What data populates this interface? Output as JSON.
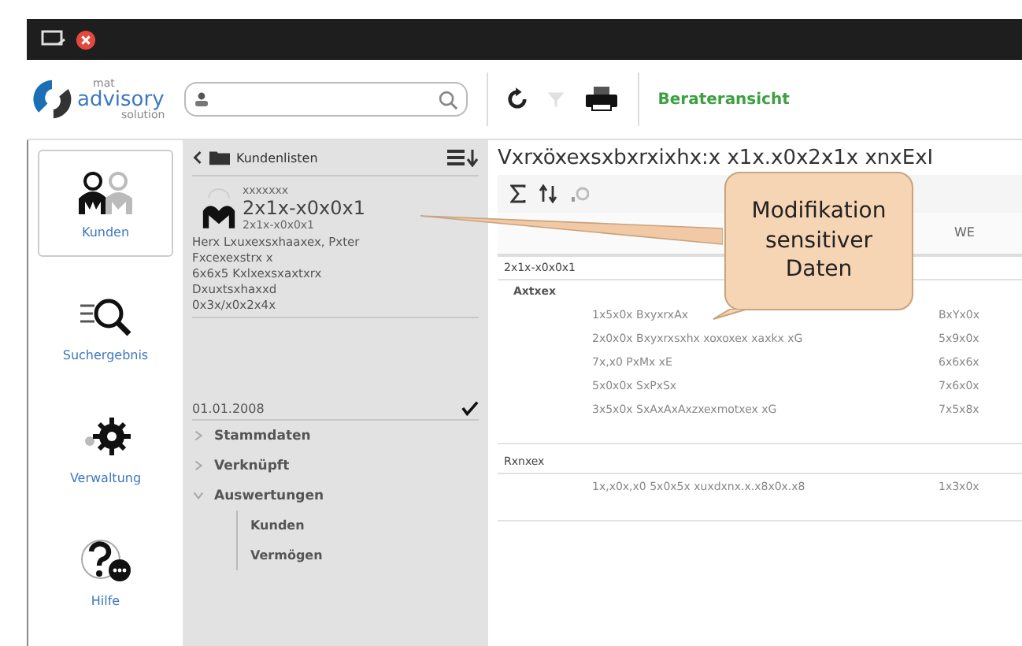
{
  "logo": {
    "small_top": "mat",
    "name": "advisory",
    "small_bottom": "solution"
  },
  "toolbar": {
    "view_label": "Berateransicht"
  },
  "nav": [
    {
      "label": "Kunden",
      "selected": true
    },
    {
      "label": "Suchergebnis",
      "selected": false
    },
    {
      "label": "Verwaltung",
      "selected": false
    },
    {
      "label": "Hilfe",
      "selected": false
    }
  ],
  "list_panel": {
    "back_label": "Kundenlisten",
    "customer": {
      "line_top": "xxxxxxx",
      "number": "2x1x-x0x0x1",
      "sub_number": "2x1x-x0x0x1"
    },
    "address": [
      "Herx Lxuxexsxhaaxex, Pxter",
      "Fxcexexstrx x",
      "6x6x5 Kxlxexsxaxtxrx",
      "Dxuxtsxhaxxd",
      "0x3x/x0x2x4x"
    ],
    "date": "01.01.2008",
    "date_checked": true,
    "tree": [
      {
        "label": "Stammdaten",
        "expanded": false
      },
      {
        "label": "Verknüpft",
        "expanded": false
      },
      {
        "label": "Auswertungen",
        "expanded": true,
        "children": [
          {
            "label": "Kunden"
          },
          {
            "label": "Vermögen"
          }
        ]
      }
    ]
  },
  "report": {
    "title": "Vxrxöxexsxbxrxixhx:x x1x.x0x2x1x xnxExI",
    "column_2": "WE",
    "groups": [
      {
        "label": "2x1x-x0x0x1",
        "subgroups": [
          {
            "label": "Axtxex",
            "rows": [
              {
                "name": "1x5x0x BxyxrxAx",
                "value": "BxYx0x"
              },
              {
                "name": "2x0x0x Bxyxrxsxhx xoxoxex xaxkx xG",
                "value": "5x9x0x"
              },
              {
                "name": "7x,x0 PxMx xE",
                "value": "6x6x6x"
              },
              {
                "name": "5x0x0x SxPxSx",
                "value": "7x6x0x"
              },
              {
                "name": "3x5x0x SxAxAxAxzxexmotxex xG",
                "value": "7x5x8x"
              }
            ]
          }
        ]
      },
      {
        "label": "Rxnxex",
        "subgroups": [
          {
            "rows": [
              {
                "name": "1x,x0x,x0 5x0x5x xuxdxnx.x.x8x0x.x8",
                "value": "1x3x0x"
              }
            ]
          }
        ]
      }
    ]
  },
  "callout": {
    "text": "Modifikation sensitiver Daten"
  }
}
